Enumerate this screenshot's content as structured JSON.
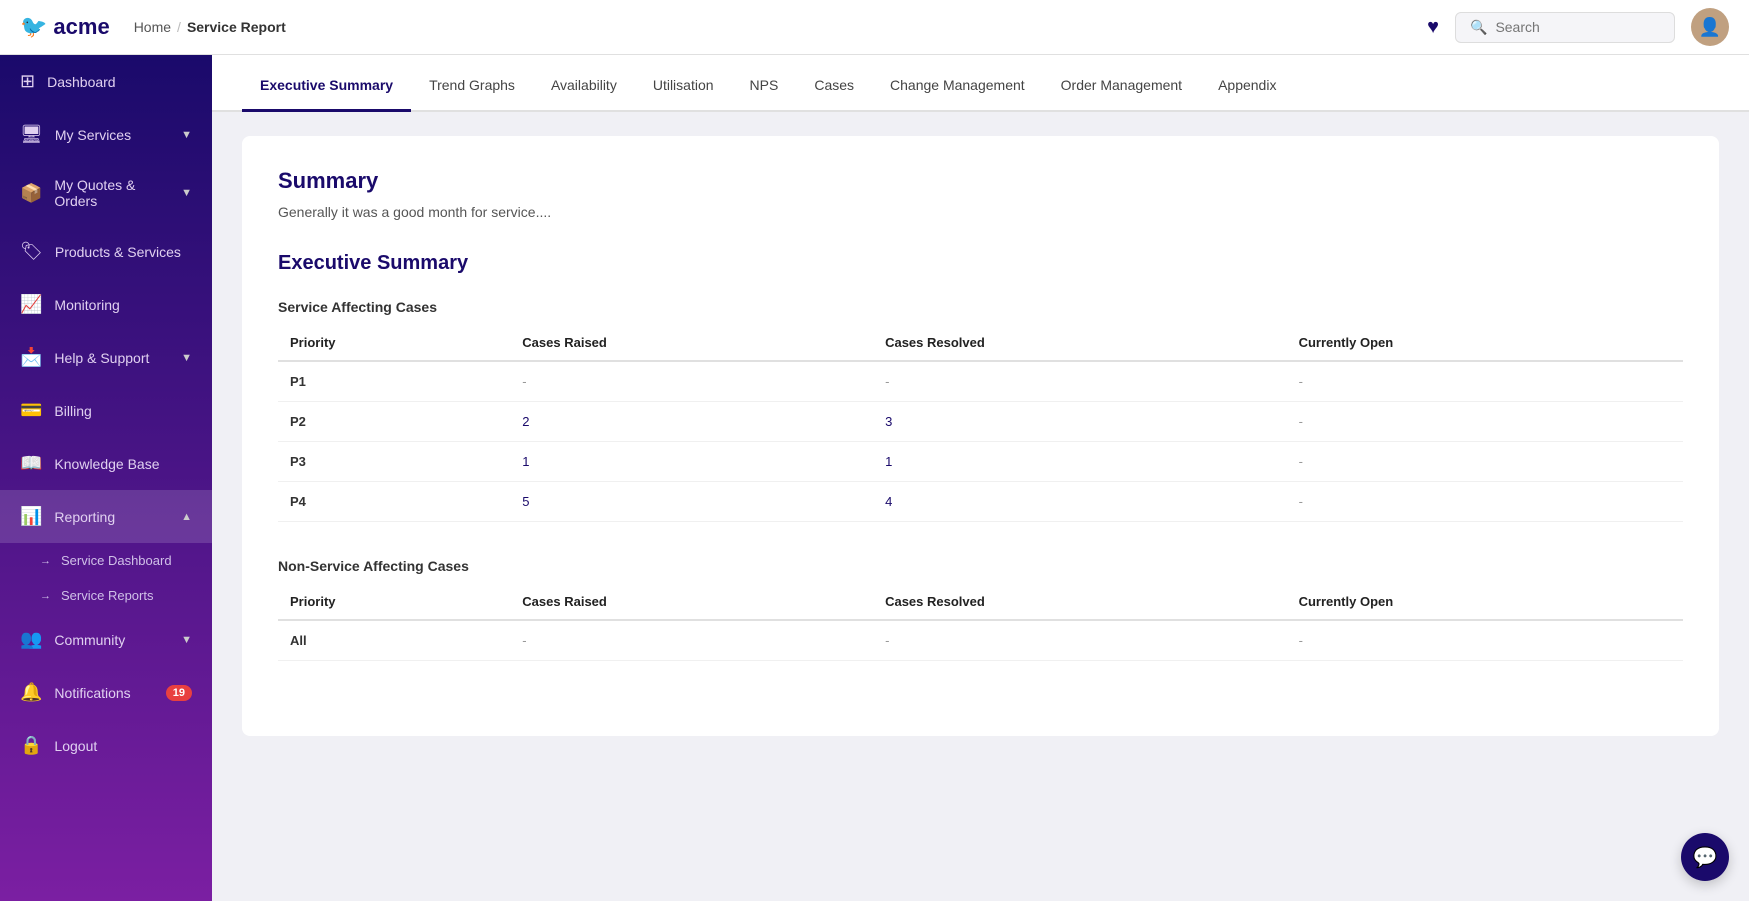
{
  "header": {
    "logo_icon": "🐦",
    "logo_text": "acme",
    "nav_home": "Home",
    "nav_separator": "/",
    "nav_current": "Service Report",
    "heart_icon": "♥",
    "search_placeholder": "Search"
  },
  "sidebar": {
    "items": [
      {
        "id": "dashboard",
        "label": "Dashboard",
        "icon": "⊞",
        "hasChevron": false,
        "badge": null
      },
      {
        "id": "my-services",
        "label": "My Services",
        "icon": "🖥",
        "hasChevron": true,
        "badge": null
      },
      {
        "id": "my-quotes-orders",
        "label": "My Quotes & Orders",
        "icon": "📦",
        "hasChevron": true,
        "badge": null
      },
      {
        "id": "products-services",
        "label": "Products & Services",
        "icon": "🏷",
        "hasChevron": false,
        "badge": null
      },
      {
        "id": "monitoring",
        "label": "Monitoring",
        "icon": "📈",
        "hasChevron": false,
        "badge": null
      },
      {
        "id": "help-support",
        "label": "Help & Support",
        "icon": "📩",
        "hasChevron": true,
        "badge": null
      },
      {
        "id": "billing",
        "label": "Billing",
        "icon": "💳",
        "hasChevron": false,
        "badge": null
      },
      {
        "id": "knowledge-base",
        "label": "Knowledge Base",
        "icon": "📖",
        "hasChevron": false,
        "badge": null
      },
      {
        "id": "reporting",
        "label": "Reporting",
        "icon": "📊",
        "hasChevron": true,
        "badge": null,
        "active": true
      },
      {
        "id": "community",
        "label": "Community",
        "icon": "👥",
        "hasChevron": true,
        "badge": null
      },
      {
        "id": "notifications",
        "label": "Notifications",
        "icon": "🔔",
        "hasChevron": false,
        "badge": "19"
      },
      {
        "id": "logout",
        "label": "Logout",
        "icon": "🔒",
        "hasChevron": false,
        "badge": null
      }
    ],
    "subitems": [
      {
        "id": "service-dashboard",
        "label": "Service Dashboard"
      },
      {
        "id": "service-reports",
        "label": "Service Reports"
      }
    ]
  },
  "tabs": [
    {
      "id": "executive-summary",
      "label": "Executive Summary",
      "active": true
    },
    {
      "id": "trend-graphs",
      "label": "Trend Graphs",
      "active": false
    },
    {
      "id": "availability",
      "label": "Availability",
      "active": false
    },
    {
      "id": "utilisation",
      "label": "Utilisation",
      "active": false
    },
    {
      "id": "nps",
      "label": "NPS",
      "active": false
    },
    {
      "id": "cases",
      "label": "Cases",
      "active": false
    },
    {
      "id": "change-management",
      "label": "Change Management",
      "active": false
    },
    {
      "id": "order-management",
      "label": "Order Management",
      "active": false
    },
    {
      "id": "appendix",
      "label": "Appendix",
      "active": false
    }
  ],
  "content": {
    "summary_title": "Summary",
    "summary_text": "Generally it was a good month for service....",
    "exec_summary_title": "Executive Summary",
    "service_affecting_title": "Service Affecting Cases",
    "service_affecting_headers": [
      "Priority",
      "Cases Raised",
      "Cases Resolved",
      "Currently Open"
    ],
    "service_affecting_rows": [
      {
        "priority": "P1",
        "raised": "-",
        "resolved": "-",
        "open": "-"
      },
      {
        "priority": "P2",
        "raised": "2",
        "resolved": "3",
        "open": "-"
      },
      {
        "priority": "P3",
        "raised": "1",
        "resolved": "1",
        "open": "-"
      },
      {
        "priority": "P4",
        "raised": "5",
        "resolved": "4",
        "open": "-"
      }
    ],
    "non_service_affecting_title": "Non-Service Affecting Cases",
    "non_service_affecting_headers": [
      "Priority",
      "Cases Raised",
      "Cases Resolved",
      "Currently Open"
    ],
    "non_service_affecting_rows": [
      {
        "priority": "All",
        "raised": "-",
        "resolved": "-",
        "open": "-"
      }
    ]
  }
}
